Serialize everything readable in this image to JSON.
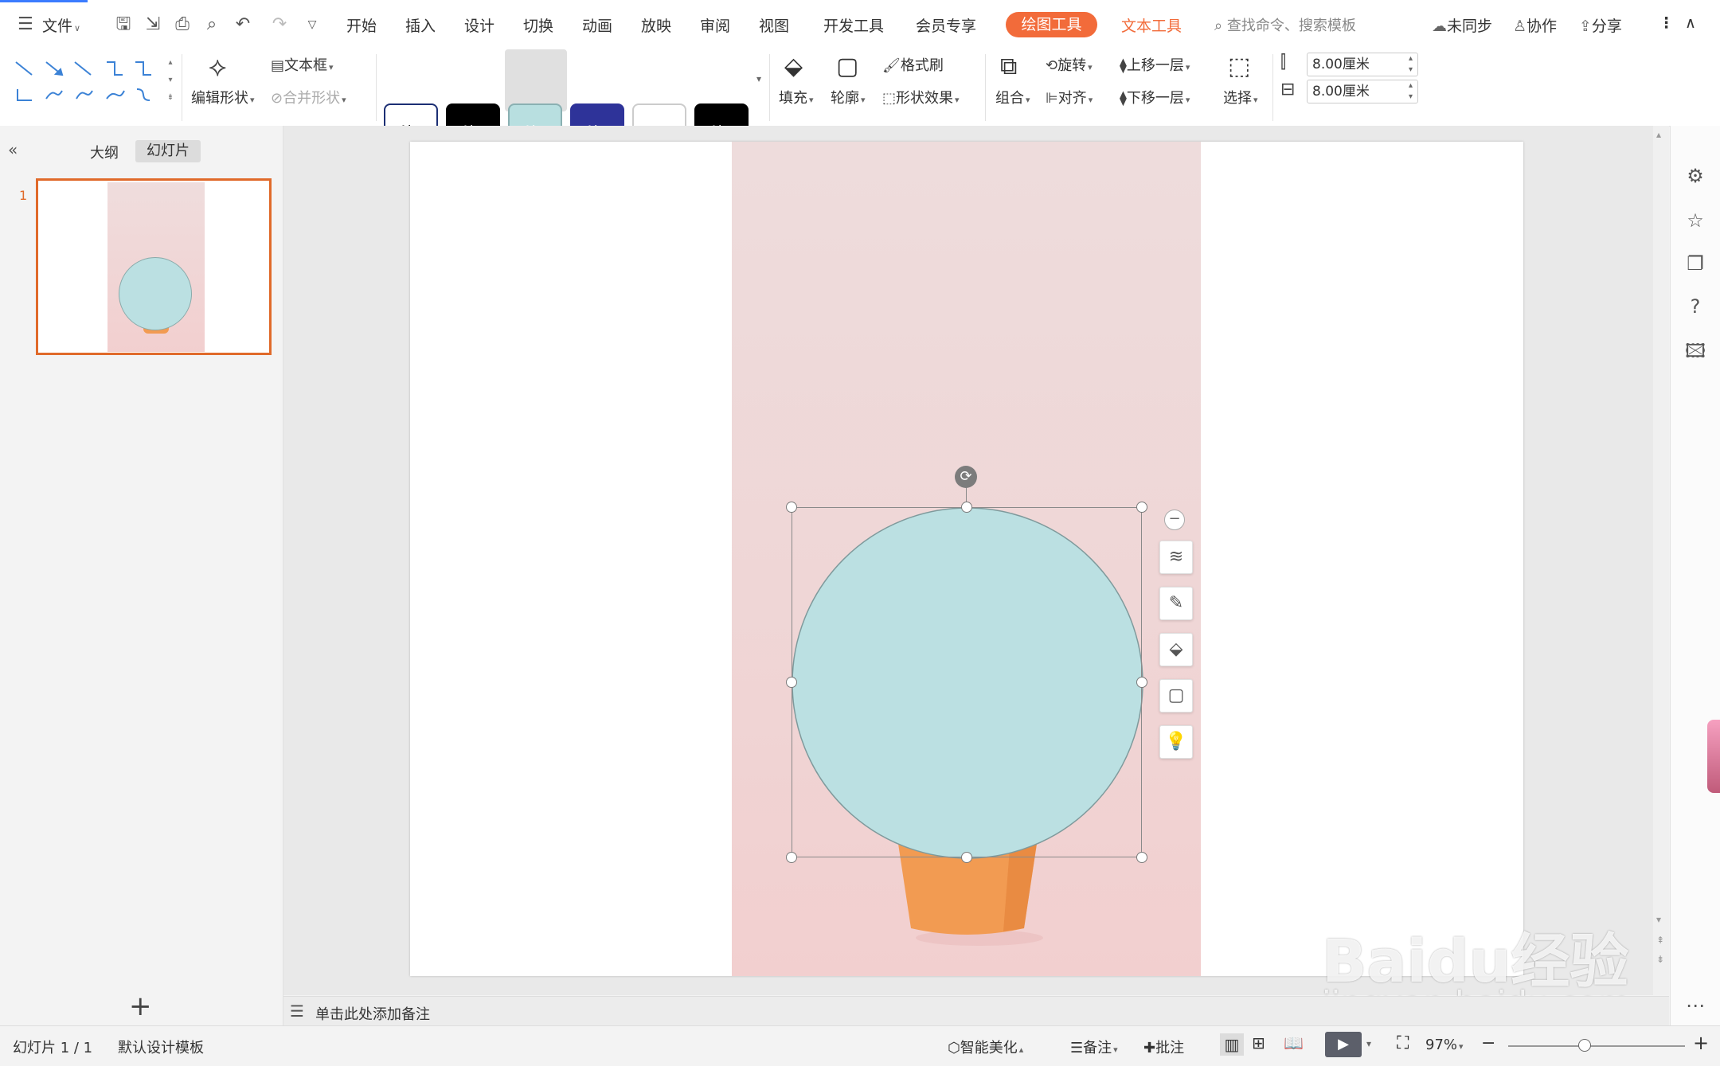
{
  "menubar": {
    "file_label": "文件",
    "tabs": [
      "开始",
      "插入",
      "设计",
      "切换",
      "动画",
      "放映",
      "审阅",
      "视图",
      "开发工具",
      "会员专享"
    ],
    "drawing_tools": "绘图工具",
    "text_tools": "文本工具",
    "search_placeholder": "查找命令、搜索模板",
    "sync": "未同步",
    "collab": "协作",
    "share": "分享"
  },
  "ribbon": {
    "edit_shape": "编辑形状",
    "text_box": "文本框",
    "merge_shape": "合并形状",
    "style_samples": [
      {
        "label": "Abc",
        "bg": "#ffffff",
        "fg": "#000000",
        "border": "#1c2f74"
      },
      {
        "label": "Abc",
        "bg": "#000000",
        "fg": "#ffffff",
        "border": "#000000"
      },
      {
        "label": "Abc",
        "bg": "#b8dfe0",
        "fg": "#ffffff",
        "border": "#8ab0b2"
      },
      {
        "label": "Abc",
        "bg": "#2e3399",
        "fg": "#ffffff",
        "border": "#2e3399"
      },
      {
        "label": "",
        "bg": "#ffffff",
        "fg": "#000000",
        "border": "#cccccc"
      },
      {
        "label": "Abc",
        "bg": "#000000",
        "fg": "#ffffff",
        "border": "#000000"
      }
    ],
    "fill": "填充",
    "outline": "轮廓",
    "format_painter": "格式刷",
    "shape_effects": "形状效果",
    "group": "组合",
    "rotate": "旋转",
    "align": "对齐",
    "bring_forward": "上移一层",
    "send_backward": "下移一层",
    "select": "选择",
    "height_value": "8.00厘米",
    "width_value": "8.00厘米"
  },
  "left_panel": {
    "tab_outline": "大纲",
    "tab_slides": "幻灯片",
    "slide_number": "1",
    "add_slide": "+"
  },
  "notes": {
    "placeholder": "单击此处添加备注"
  },
  "status": {
    "slide_info": "幻灯片 1 / 1",
    "template": "默认设计模板",
    "smart_beautify": "智能美化",
    "notes_label": "备注",
    "comment_label": "批注",
    "zoom": "97%"
  },
  "watermark": {
    "brand": "Baidu经验",
    "url": "jingyan.baidu.com"
  },
  "colors": {
    "accent": "#f26b3a",
    "shape_fill": "#bbe0e2",
    "pot": "#f29b52",
    "thumb_border": "#e06a2a"
  }
}
